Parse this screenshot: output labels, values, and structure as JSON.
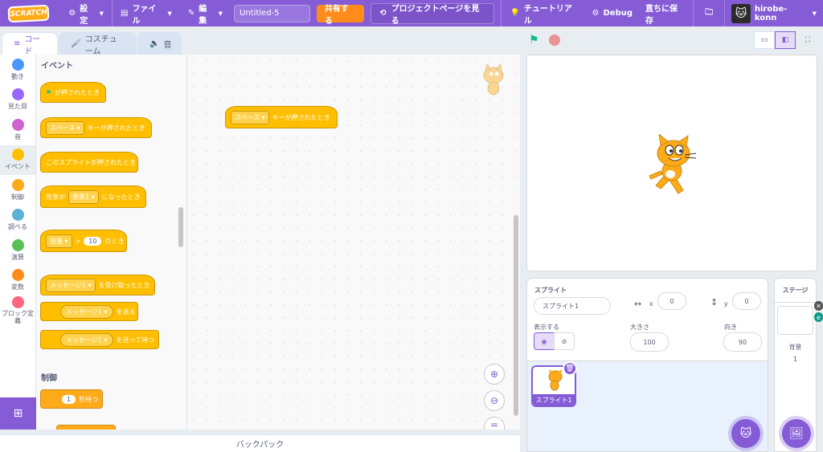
{
  "menubar": {
    "logo": "SCRATCH",
    "settings": "設定",
    "file": "ファイル",
    "edit": "編集",
    "project_title": "Untitled-5",
    "share": "共有する",
    "project_page": "プロジェクトページを見る",
    "tutorials": "チュートリアル",
    "debug": "Debug",
    "save_now": "直ちに保存",
    "username": "hirobe-konn"
  },
  "tabs": {
    "code": "コード",
    "costumes": "コスチューム",
    "sounds": "音"
  },
  "categories": [
    {
      "label": "動き",
      "color": "#4c97ff"
    },
    {
      "label": "見た目",
      "color": "#9966ff"
    },
    {
      "label": "音",
      "color": "#cf63cf"
    },
    {
      "label": "イベント",
      "color": "#ffbf00"
    },
    {
      "label": "制御",
      "color": "#ffab19"
    },
    {
      "label": "調べる",
      "color": "#5cb1d6"
    },
    {
      "label": "演算",
      "color": "#59c059"
    },
    {
      "label": "変数",
      "color": "#ff8c1a"
    },
    {
      "label": "ブロック定義",
      "color": "#ff6680"
    }
  ],
  "palette": {
    "events_heading": "イベント",
    "control_heading": "制御",
    "flag_clicked": "が押されたとき",
    "key_space": "スペース",
    "key_pressed": "キーが押されたとき",
    "sprite_clicked": "このスプライトが押されたとき",
    "backdrop_prefix": "背景が",
    "backdrop_value": "背景1",
    "backdrop_suffix": "になったとき",
    "loudness": "音量",
    "gt": ">",
    "loudness_value": "10",
    "loudness_suffix": "のとき",
    "message1": "メッセージ1",
    "when_receive": "を受け取ったとき",
    "broadcast": "を送る",
    "broadcast_wait": "を送って待つ",
    "wait_value": "1",
    "wait_label": "秒待つ"
  },
  "script": {
    "key_space": "スペース",
    "key_pressed": "キーが押されたとき"
  },
  "backpack": "バックパック",
  "sprite_info": {
    "sprite_label": "スプライト",
    "sprite_name": "スプライト1",
    "x_label": "x",
    "x_value": "0",
    "y_label": "y",
    "y_value": "0",
    "show_label": "表示する",
    "size_label": "大きさ",
    "size_value": "100",
    "direction_label": "向き",
    "direction_value": "90"
  },
  "sprite_list": [
    {
      "name": "スプライト1"
    }
  ],
  "stage_pane": {
    "title": "ステージ",
    "backdrops_label": "背景",
    "backdrops_count": "1"
  }
}
